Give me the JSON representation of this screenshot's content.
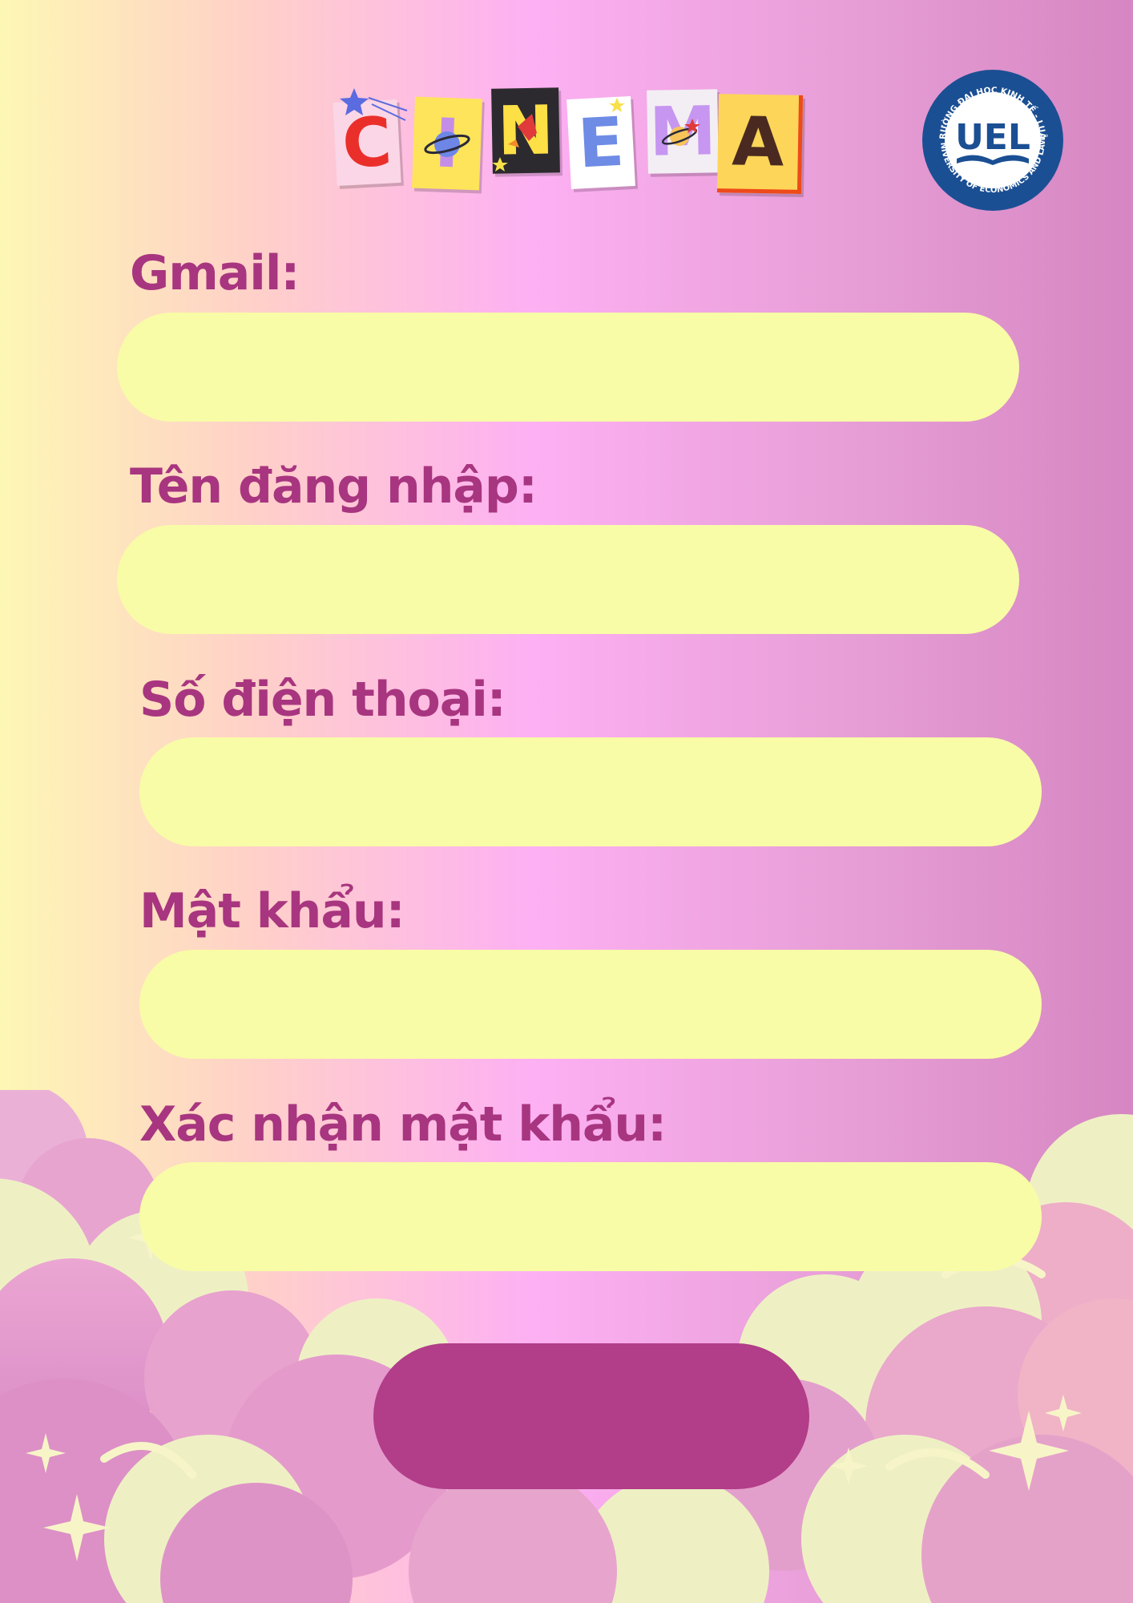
{
  "header": {
    "title_letters": [
      "C",
      "I",
      "N",
      "E",
      "M",
      "A"
    ],
    "logo": {
      "abbreviation": "UEL",
      "arc_top": "TRƯỜNG ĐẠI HỌC KINH TẾ - LUẬT",
      "arc_bottom": "UNIVERSITY OF ECONOMICS AND LAW",
      "color": "#1b4f93"
    }
  },
  "form": {
    "fields": [
      {
        "label": "Gmail:",
        "value": ""
      },
      {
        "label": "Tên đăng nhập:",
        "value": ""
      },
      {
        "label": "Số điện thoại:",
        "value": ""
      },
      {
        "label": "Mật khẩu:",
        "value": ""
      },
      {
        "label": "Xác nhận mật khẩu:",
        "value": ""
      }
    ],
    "submit_label": ""
  },
  "colors": {
    "label": "#a8357f",
    "input_fill": "#f8fca6",
    "button": "#b23d88",
    "cloud_pink": "#e7a0cc",
    "cloud_cream": "#eef0c4"
  },
  "icons": [
    "star-icon",
    "planet-icon",
    "rocket-icon",
    "sparkle-icon",
    "cloud-icon"
  ]
}
